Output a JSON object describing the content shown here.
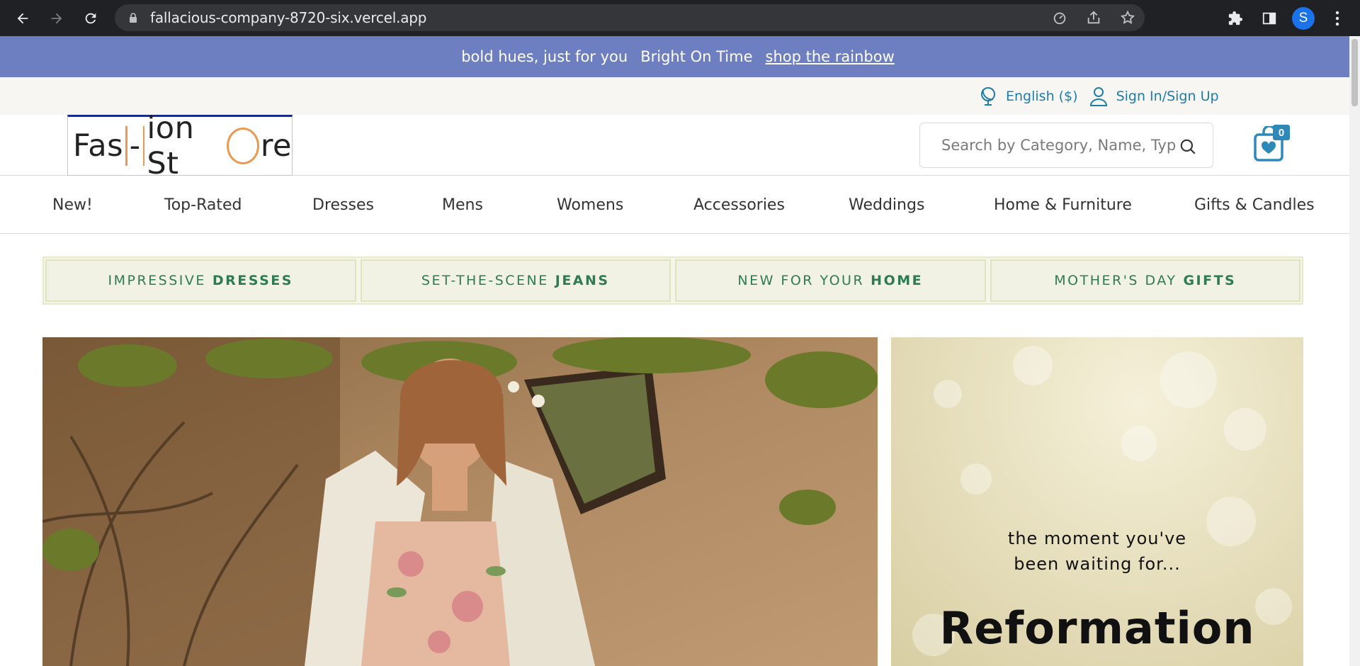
{
  "browser": {
    "url": "fallacious-company-8720-six.vercel.app",
    "profile_initial": "S"
  },
  "promo": {
    "text1": "bold hues, just for you",
    "text2": "Bright On Time",
    "link": "shop the rainbow",
    "bg_color": "#6d7fc1"
  },
  "utility": {
    "language": "English ($)",
    "signin": "Sign In/Sign Up",
    "accent_color": "#1d7ea8"
  },
  "header": {
    "logo": {
      "part1": "Fas",
      "part2": "-",
      "part3": "ion St",
      "part4": "re"
    },
    "search_placeholder": "Search by Category, Name, Type ...",
    "cart_count": "0"
  },
  "nav": {
    "items": [
      "New!",
      "Top-Rated",
      "Dresses",
      "Mens",
      "Womens",
      "Accessories",
      "Weddings",
      "Home & Furniture",
      "Gifts & Candles"
    ]
  },
  "tiles": [
    {
      "light": "IMPRESSIVE",
      "bold": "DRESSES"
    },
    {
      "light": "SET-THE-SCENE",
      "bold": "JEANS"
    },
    {
      "light": "NEW FOR YOUR",
      "bold": "HOME"
    },
    {
      "light": "MOTHER'S DAY",
      "bold": "GIFTS"
    }
  ],
  "side_banner": {
    "line1": "the moment you've",
    "line2": "been waiting for...",
    "brand": "Reformation"
  }
}
